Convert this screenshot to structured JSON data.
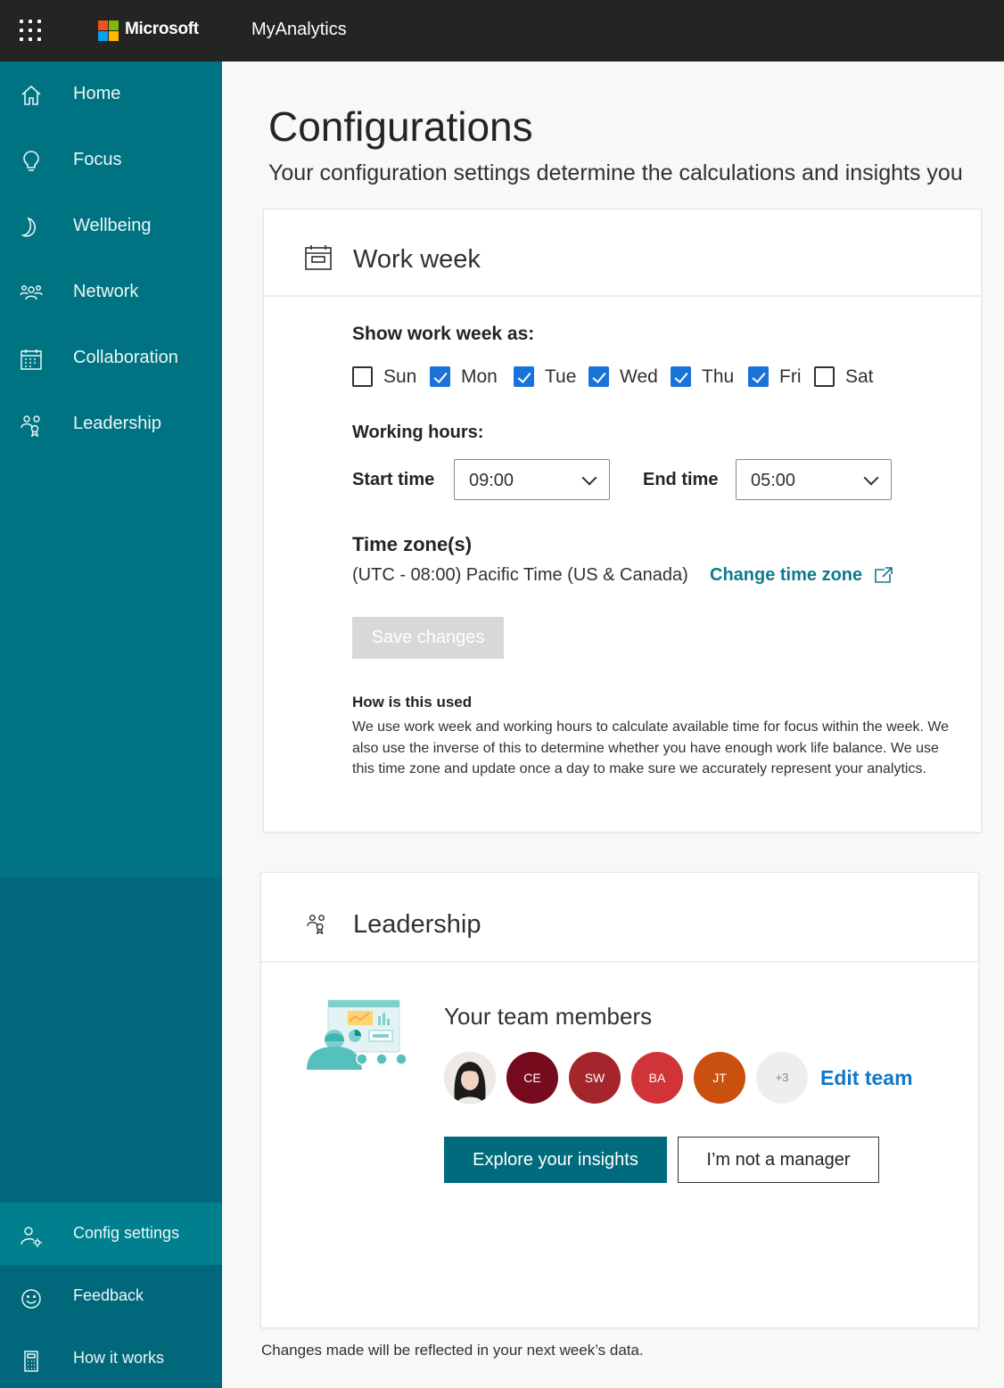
{
  "topbar": {
    "brand": "Microsoft",
    "app_name": "MyAnalytics"
  },
  "sidebar": {
    "items": [
      {
        "label": "Home",
        "icon": "home-icon"
      },
      {
        "label": "Focus",
        "icon": "lightbulb-icon"
      },
      {
        "label": "Wellbeing",
        "icon": "moon-icon"
      },
      {
        "label": "Network",
        "icon": "network-icon"
      },
      {
        "label": "Collaboration",
        "icon": "calendar-grid-icon"
      },
      {
        "label": "Leadership",
        "icon": "leadership-icon"
      }
    ],
    "bottom_items": [
      {
        "label": "Config settings",
        "icon": "user-gear-icon",
        "active": true
      },
      {
        "label": "Feedback",
        "icon": "smiley-icon"
      },
      {
        "label": "How it works",
        "icon": "calculator-icon"
      }
    ]
  },
  "page": {
    "title": "Configurations",
    "subtitle": "Your configuration settings determine the calculations and insights you"
  },
  "work_week": {
    "title": "Work week",
    "show_label": "Show work week as:",
    "days": [
      {
        "label": "Sun",
        "checked": false
      },
      {
        "label": "Mon",
        "checked": true
      },
      {
        "label": "Tue",
        "checked": true
      },
      {
        "label": "Wed",
        "checked": true
      },
      {
        "label": "Thu",
        "checked": true
      },
      {
        "label": "Fri",
        "checked": true
      },
      {
        "label": "Sat",
        "checked": false
      }
    ],
    "hours_label": "Working hours:",
    "start_label": "Start time",
    "start_value": "09:00",
    "end_label": "End time",
    "end_value": "05:00",
    "tz_label": "Time zone(s)",
    "tz_value": "(UTC - 08:00) Pacific Time (US & Canada)",
    "tz_link": "Change time zone",
    "save_label": "Save changes",
    "how_title": "How is this used",
    "how_body": "We use work week and working hours to calculate available time for focus within the week. We also use the inverse of this to determine whether you have enough work life balance. We use this time zone and update once a day to make sure we accurately represent your analytics."
  },
  "leadership": {
    "title": "Leadership",
    "team_title": "Your team members",
    "members": [
      {
        "initials": "",
        "color": "#cccccc",
        "photo": true
      },
      {
        "initials": "CE",
        "color": "#750b1c"
      },
      {
        "initials": "SW",
        "color": "#a4262c"
      },
      {
        "initials": "BA",
        "color": "#d13438"
      },
      {
        "initials": "JT",
        "color": "#ca5010"
      },
      {
        "initials": "+3",
        "color": "#eeeeee"
      }
    ],
    "edit_label": "Edit team",
    "explore_label": "Explore your insights",
    "not_manager_label": "I’m not a manager"
  },
  "footnote": "Changes made will be reflected in your next week’s data."
}
